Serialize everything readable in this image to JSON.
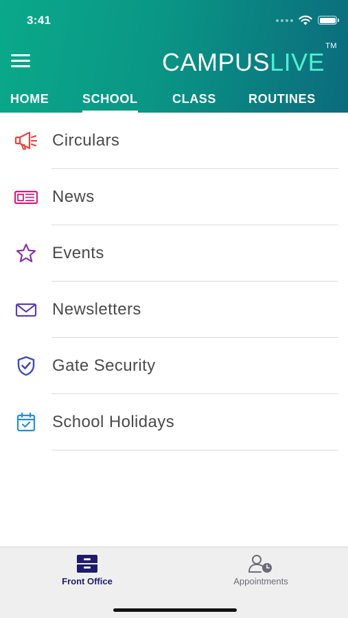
{
  "status_bar": {
    "time": "3:41",
    "icons": [
      "signal-dots-icon",
      "wifi-icon",
      "battery-icon"
    ]
  },
  "header": {
    "menu_icon": "hamburger-menu-icon",
    "brand_part1": "CAMPUS",
    "brand_part2": "LIVE",
    "brand_tm": "TM",
    "colors": {
      "gradient_start": "#0aa98a",
      "gradient_end": "#0b6b7d",
      "brand_accent": "#4ff0cf"
    }
  },
  "tabs": [
    {
      "label": "HOME",
      "active": false
    },
    {
      "label": "SCHOOL",
      "active": true
    },
    {
      "label": "CLASS",
      "active": false
    },
    {
      "label": "ROUTINES",
      "active": false
    }
  ],
  "list_items": [
    {
      "label": "Circulars",
      "icon": "megaphone-icon",
      "color": "#e8413c"
    },
    {
      "label": "News",
      "icon": "newspaper-icon",
      "color": "#d81b7a"
    },
    {
      "label": "Events",
      "icon": "star-icon",
      "color": "#8e2ea8"
    },
    {
      "label": "Newsletters",
      "icon": "envelope-icon",
      "color": "#5b3fb8"
    },
    {
      "label": "Gate Security",
      "icon": "shield-check-icon",
      "color": "#3a4bb8"
    },
    {
      "label": "School Holidays",
      "icon": "calendar-check-icon",
      "color": "#1e90e0"
    }
  ],
  "bottom_nav": [
    {
      "label": "Front Office",
      "icon": "cabinet-icon",
      "active": true
    },
    {
      "label": "Appointments",
      "icon": "person-clock-icon",
      "active": false
    }
  ]
}
